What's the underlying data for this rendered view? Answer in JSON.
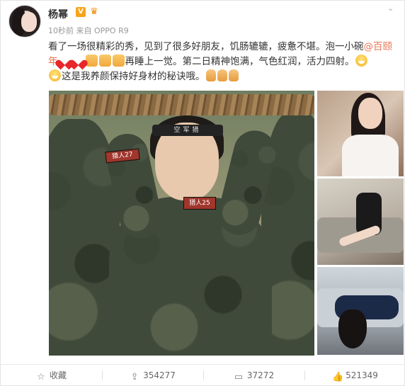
{
  "post": {
    "user_name": "杨幂",
    "verified_badge": "V",
    "member_icon": "crown-icon",
    "timestamp": "10秒前",
    "source_prefix": "来自",
    "source": "OPPO R9",
    "text_part1": "看了一场很精彩的秀，见到了很多好朋友，饥肠辘辘，疲惫不堪。泡一小碗",
    "mention": "@百颐年",
    "text_part2": "再睡上一觉。第二日精神饱满，气色红润，活力四射。",
    "text_part3": "这是我养颜保持好身材的秘诀哦。",
    "emojis": [
      "heart",
      "heart",
      "thumbs-up",
      "thumbs-up",
      "thumbs-up",
      "grin",
      "grin",
      "victory",
      "victory",
      "victory"
    ]
  },
  "images": {
    "main_headband_text": "空军猎",
    "main_name_patch": "猎人25",
    "side_name_patch": "猎人27"
  },
  "actions": {
    "favorite_label": "收藏",
    "share_count": "354277",
    "comment_count": "37272",
    "like_count": "521349"
  },
  "colors": {
    "mention": "#eb7350",
    "verified": "#f7a51a"
  }
}
